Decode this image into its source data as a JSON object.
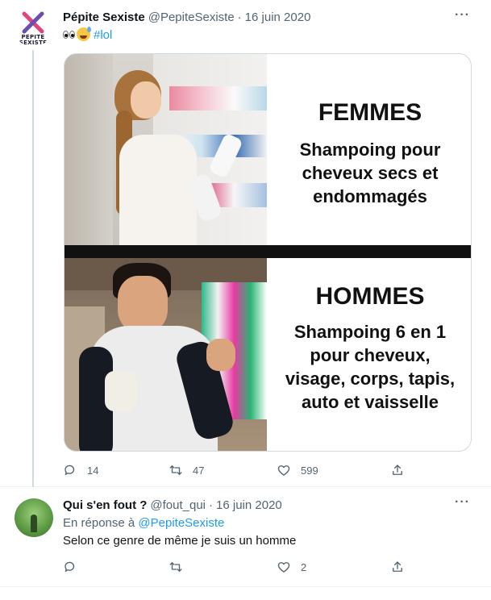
{
  "tweet1": {
    "author_name": "Pépite Sexiste",
    "handle": "@PepiteSexiste",
    "separator": "·",
    "date": "16 juin 2020",
    "more": "···",
    "avatar_logo_line1": "PEPITE",
    "avatar_logo_line2": "SEXISTE",
    "hashtag": "#lol",
    "emojis": [
      "eyes-emoji",
      "grinning-sweat-emoji"
    ],
    "media": {
      "top_title": "FEMMES",
      "top_body": [
        "Shampoing pour",
        "cheveux secs et",
        "endommagés"
      ],
      "bottom_title": "HOMMES",
      "bottom_body": [
        "Shampoing 6 en 1",
        "pour cheveux,",
        "visage, corps, tapis,",
        "auto et vaisselle"
      ]
    },
    "replies": "14",
    "retweets": "47",
    "likes": "599"
  },
  "tweet2": {
    "author_name": "Qui s'en fout ?",
    "handle": "@fout_qui",
    "separator": "·",
    "date": "16 juin 2020",
    "more": "···",
    "reply_prefix": "En réponse à",
    "reply_mention": "@PepiteSexiste",
    "text": "Selon ce genre de même je suis un homme",
    "replies": "",
    "retweets": "",
    "likes": "2"
  },
  "colors": {
    "accent": "#1d9bf0",
    "secondary_text": "#536471",
    "border": "#cfd9de",
    "logo_pink": "#e2437b",
    "logo_purple": "#6a4fb0"
  },
  "icons": [
    "reply-icon",
    "retweet-icon",
    "like-icon",
    "share-icon",
    "more-icon"
  ]
}
